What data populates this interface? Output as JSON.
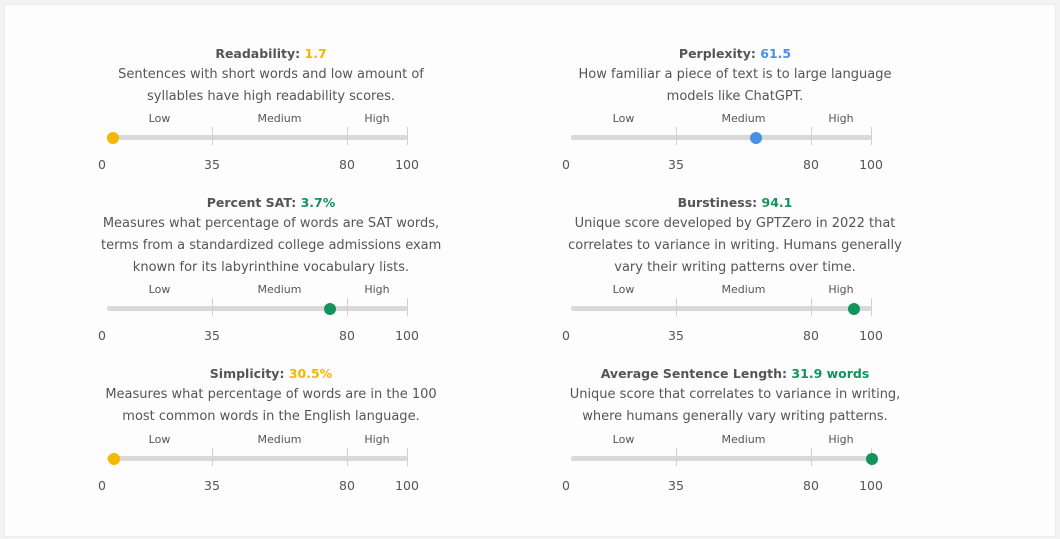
{
  "levels": {
    "low": "Low",
    "medium": "Medium",
    "high": "High"
  },
  "ticks": [
    "0",
    "35",
    "80",
    "100"
  ],
  "metrics": [
    {
      "label": "Readability:",
      "value": "1.7",
      "score": 1.7,
      "color": "#f5b700",
      "desc": [
        "Sentences with short words and low amount of",
        "syllables have high readability scores."
      ]
    },
    {
      "label": "Perplexity:",
      "value": "61.5",
      "score": 61.5,
      "color": "#4a90e2",
      "desc": [
        "How familiar a piece of text is to large language",
        "models like ChatGPT."
      ]
    },
    {
      "label": "Percent SAT:",
      "value": "3.7%",
      "score": 74,
      "color": "#15935c",
      "desc": [
        "Measures what percentage of words are SAT words,",
        "terms from a standardized college admissions exam",
        "known for its labyrinthine vocabulary lists."
      ]
    },
    {
      "label": "Burstiness:",
      "value": "94.1",
      "score": 94.1,
      "color": "#15935c",
      "desc": [
        "Unique score developed by GPTZero in 2022 that",
        "correlates to variance in writing. Humans generally",
        "vary their writing patterns over time."
      ]
    },
    {
      "label": "Simplicity:",
      "value": "30.5%",
      "score": 2,
      "color": "#f5b700",
      "desc": [
        "Measures what percentage of words are in the 100",
        "most common words in the English language."
      ]
    },
    {
      "label": "Average Sentence Length:",
      "value": "31.9 words",
      "score": 100,
      "color": "#15935c",
      "desc": [
        "Unique score that correlates to variance in writing,",
        "where humans generally vary writing patterns."
      ]
    }
  ]
}
